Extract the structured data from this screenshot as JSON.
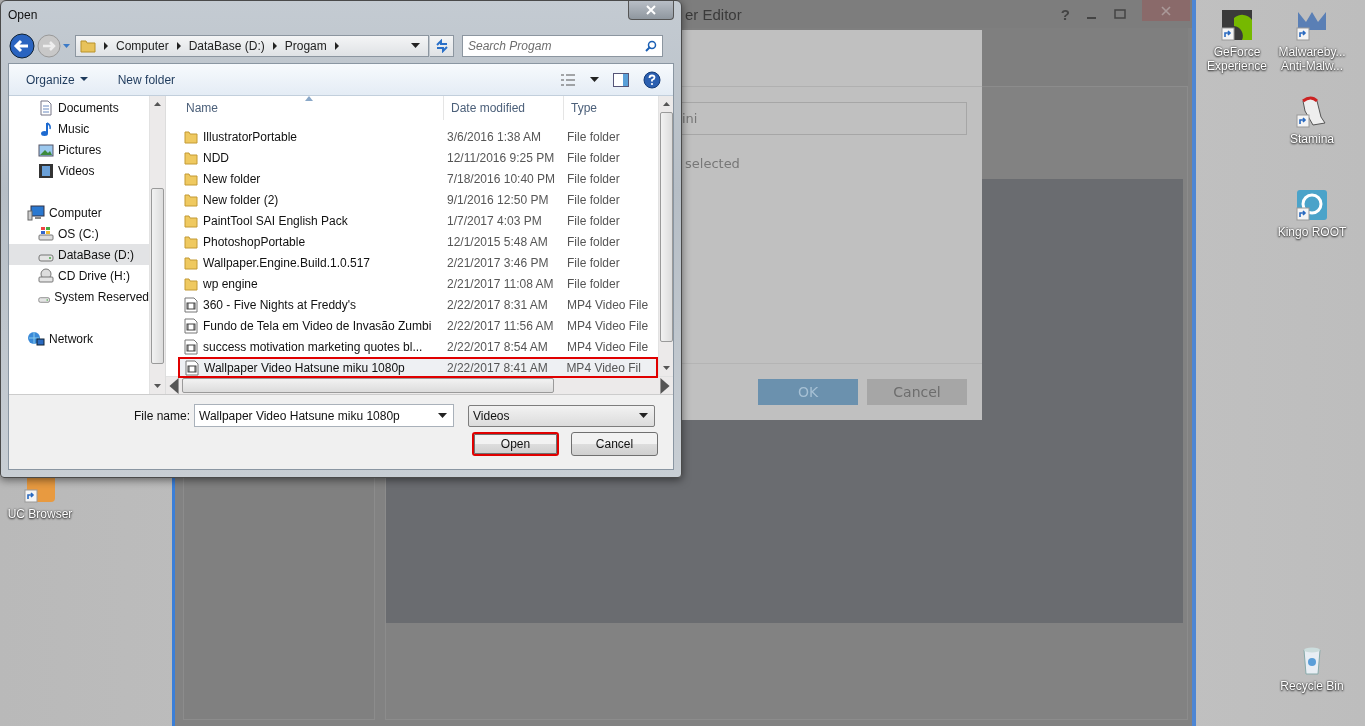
{
  "desktop_icons": [
    {
      "kind": "browser",
      "lines": [
        "UC Browser"
      ]
    },
    {
      "kind": "gpu",
      "lines": [
        "GeForce",
        "Experience"
      ]
    },
    {
      "kind": "shield",
      "lines": [
        "Malwareby...",
        "Anti-Malw..."
      ]
    },
    {
      "kind": "stamina",
      "lines": [
        "Stamina"
      ]
    },
    {
      "kind": "lock",
      "lines": [
        "Kingo ROOT"
      ]
    },
    {
      "kind": "bin",
      "lines": [
        "Recycle Bin"
      ]
    }
  ],
  "background_window": {
    "title": "er Editor",
    "help": "?",
    "dialog": {
      "field_value": "ini",
      "status_text": "selected",
      "buttons": [
        {
          "label": "OK",
          "kind": "primary"
        },
        {
          "label": "Cancel",
          "kind": "secondary"
        }
      ]
    }
  },
  "open_dialog": {
    "title": "Open",
    "breadcrumb": [
      "Computer",
      "DataBase (D:)",
      "Progam"
    ],
    "search": {
      "placeholder": "Search Progam"
    },
    "toolbar": [
      "Organize",
      "New folder"
    ],
    "nav": [
      {
        "children": [
          {
            "label": "Documents",
            "kind": "documents",
            "selected": false
          },
          {
            "label": "Music",
            "kind": "music",
            "selected": false
          },
          {
            "label": "Pictures",
            "kind": "pictures",
            "selected": false
          },
          {
            "label": "Videos",
            "kind": "videos",
            "selected": false
          }
        ]
      },
      {
        "label": "Computer",
        "kind": "computer",
        "selected": false,
        "children": [
          {
            "label": "OS (C:)",
            "kind": "osdrive",
            "selected": false
          },
          {
            "label": "DataBase (D:)",
            "kind": "drive",
            "selected": true
          },
          {
            "label": "CD Drive (H:)",
            "kind": "cddrive",
            "selected": false
          },
          {
            "label": "System Reserved",
            "kind": "drive",
            "selected": false
          }
        ]
      },
      {
        "label": "Network",
        "kind": "network",
        "selected": false
      }
    ],
    "columns": [
      "Name",
      "Date modified",
      "Type"
    ],
    "rows": [
      {
        "name": "IllustratorPortable",
        "date": "3/6/2016 1:38 AM",
        "type": "File folder",
        "kind": "folder",
        "selected": false
      },
      {
        "name": "NDD",
        "date": "12/11/2016 9:25 PM",
        "type": "File folder",
        "kind": "folder",
        "selected": false
      },
      {
        "name": "New folder",
        "date": "7/18/2016 10:40 PM",
        "type": "File folder",
        "kind": "folder",
        "selected": false
      },
      {
        "name": "New folder (2)",
        "date": "9/1/2016 12:50 PM",
        "type": "File folder",
        "kind": "folder",
        "selected": false
      },
      {
        "name": "PaintTool SAI English Pack",
        "date": "1/7/2017 4:03 PM",
        "type": "File folder",
        "kind": "folder",
        "selected": false
      },
      {
        "name": "PhotoshopPortable",
        "date": "12/1/2015 5:48 AM",
        "type": "File folder",
        "kind": "folder",
        "selected": false
      },
      {
        "name": "Wallpaper.Engine.Build.1.0.517",
        "date": "2/21/2017 3:46 PM",
        "type": "File folder",
        "kind": "folder",
        "selected": false
      },
      {
        "name": "wp engine",
        "date": "2/21/2017 11:08 AM",
        "type": "File folder",
        "kind": "folder",
        "selected": false
      },
      {
        "name": "360 - Five Nights at Freddy's",
        "date": "2/22/2017 8:31 AM",
        "type": "MP4 Video File",
        "kind": "video",
        "selected": false
      },
      {
        "name": "Fundo de Tela em Video de Invasão Zumbi",
        "date": "2/22/2017 11:56 AM",
        "type": "MP4 Video File",
        "kind": "video",
        "selected": false
      },
      {
        "name": "success motivation  marketing quotes bl...",
        "date": "2/22/2017 8:54 AM",
        "type": "MP4 Video File",
        "kind": "video",
        "selected": false
      },
      {
        "name": "Wallpaper Video Hatsune miku 1080p",
        "date": "2/22/2017 8:41 AM",
        "type": "MP4 Video Fil",
        "kind": "video",
        "selected": true
      }
    ],
    "file_name_label": "File name:",
    "file_name": "Wallpaper Video Hatsune miku 1080p",
    "file_type": "Videos",
    "buttons": [
      {
        "label": "Open",
        "highlighted": true
      },
      {
        "label": "Cancel",
        "highlighted": false
      }
    ]
  }
}
